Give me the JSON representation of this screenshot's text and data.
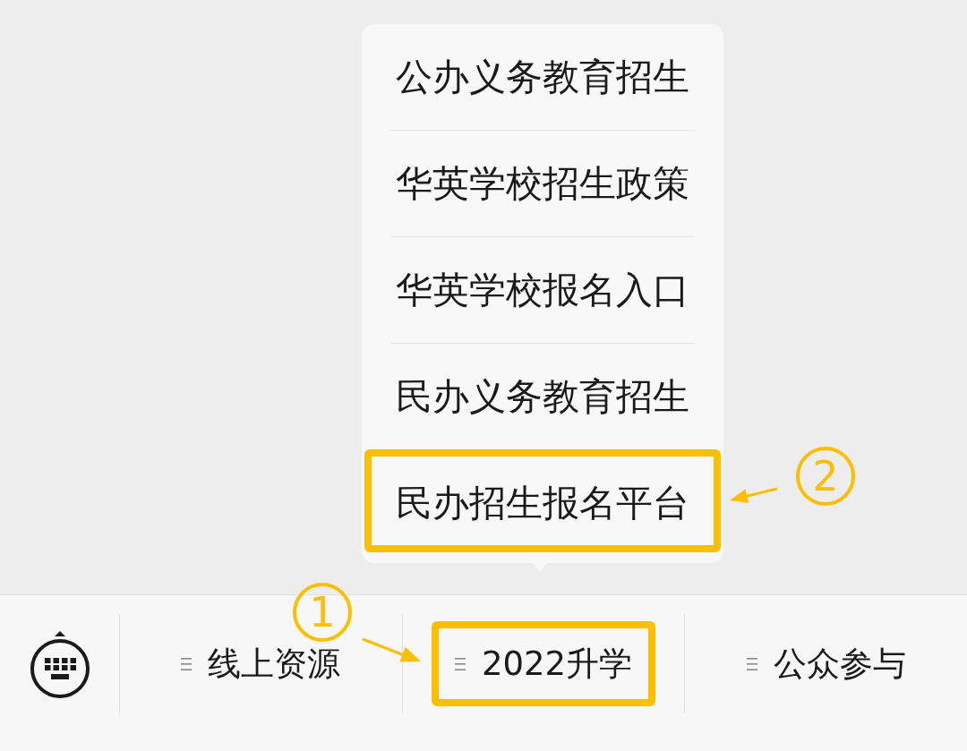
{
  "menu": {
    "items": [
      {
        "label": "公办义务教育招生",
        "highlighted": false
      },
      {
        "label": "华英学校招生政策",
        "highlighted": false
      },
      {
        "label": "华英学校报名入口",
        "highlighted": false
      },
      {
        "label": "民办义务教育招生",
        "highlighted": false
      },
      {
        "label": "民办招生报名平台",
        "highlighted": true,
        "callout": "2"
      }
    ]
  },
  "bottom_bar": {
    "tabs": [
      {
        "label": "线上资源",
        "highlighted": false
      },
      {
        "label": "2022升学",
        "highlighted": true,
        "callout": "1"
      },
      {
        "label": "公众参与",
        "highlighted": false
      }
    ]
  }
}
